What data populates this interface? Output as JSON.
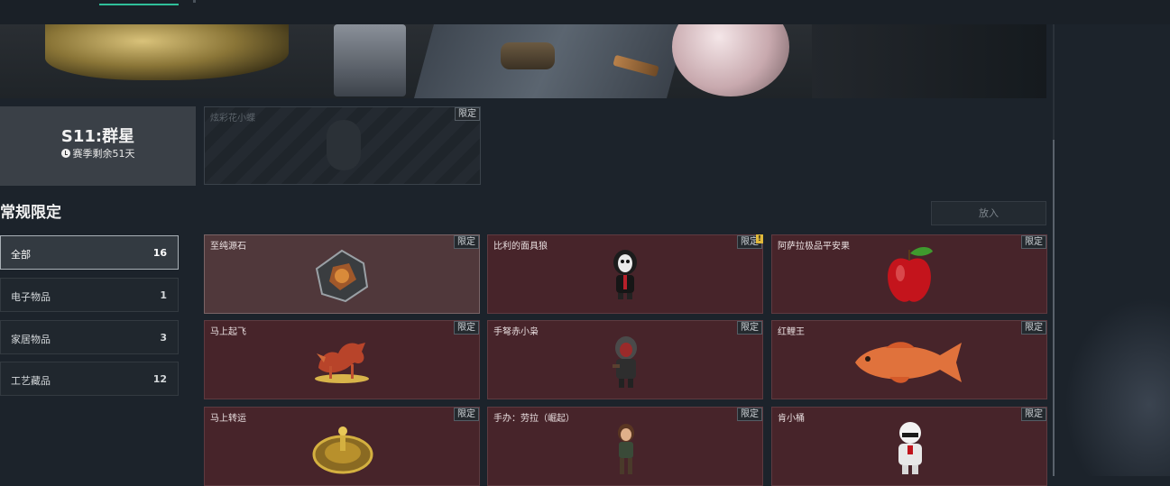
{
  "season": {
    "title": "S11:群星",
    "remaining": "赛季剩余51天"
  },
  "featured": {
    "name": "炫彩花小蝶",
    "tag": "限定"
  },
  "section": {
    "title": "常规限定",
    "put_in_label": "放入"
  },
  "categories": [
    {
      "label": "全部",
      "count": "16"
    },
    {
      "label": "电子物品",
      "count": "1"
    },
    {
      "label": "家居物品",
      "count": "3"
    },
    {
      "label": "工艺藏品",
      "count": "12"
    }
  ],
  "items": [
    {
      "name": "至纯源石",
      "tag": "限定",
      "icon": "crystal-icon"
    },
    {
      "name": "比利的面具狼",
      "tag": "限定",
      "icon": "mask-figure-icon"
    },
    {
      "name": "阿萨拉极品平安果",
      "tag": "限定",
      "icon": "apple-icon"
    },
    {
      "name": "马上起飞",
      "tag": "限定",
      "icon": "horse-icon"
    },
    {
      "name": "手弩赤小枭",
      "tag": "限定",
      "icon": "hooded-figure-icon"
    },
    {
      "name": "红鲤王",
      "tag": "限定",
      "icon": "carp-icon"
    },
    {
      "name": "马上转运",
      "tag": "限定",
      "icon": "wheel-icon"
    },
    {
      "name": "手办：劳拉（崛起）",
      "tag": "限定",
      "icon": "lara-figure-icon"
    },
    {
      "name": "肯小桶",
      "tag": "限定",
      "icon": "chef-figure-icon"
    }
  ],
  "colors": {
    "item_bg": "#47242a",
    "accent": "#2fbf9a",
    "warning": "#e0b83a"
  }
}
